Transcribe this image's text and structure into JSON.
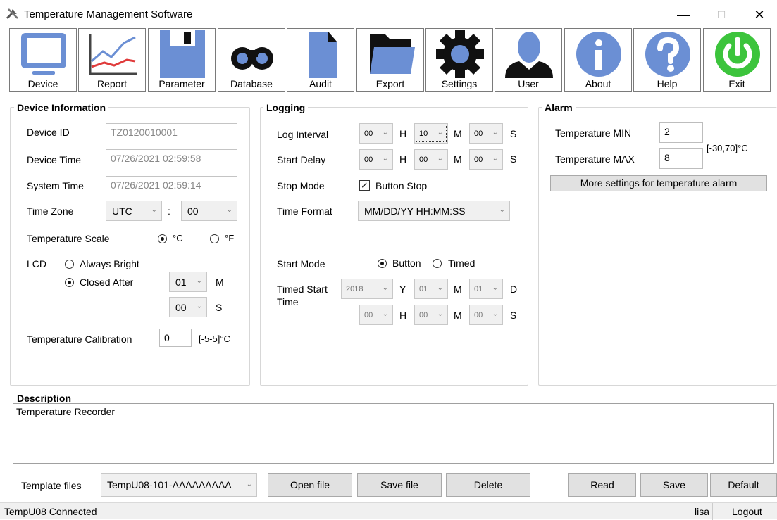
{
  "window": {
    "title": "Temperature Management Software",
    "minimize": "—",
    "maximize": "☐",
    "close": "✕"
  },
  "toolbar": [
    {
      "label": "Device",
      "icon": "monitor-icon"
    },
    {
      "label": "Report",
      "icon": "line-chart-icon"
    },
    {
      "label": "Parameter",
      "icon": "floppy-disk-icon"
    },
    {
      "label": "Database",
      "icon": "binoculars-icon"
    },
    {
      "label": "Audit",
      "icon": "document-icon"
    },
    {
      "label": "Export",
      "icon": "folder-icon"
    },
    {
      "label": "Settings",
      "icon": "gear-icon"
    },
    {
      "label": "User",
      "icon": "user-icon"
    },
    {
      "label": "About",
      "icon": "info-icon"
    },
    {
      "label": "Help",
      "icon": "help-icon"
    },
    {
      "label": "Exit",
      "icon": "power-icon"
    }
  ],
  "device": {
    "title": "Device Information",
    "id_label": "Device ID",
    "id_value": "TZ0120010001",
    "time_label": "Device Time",
    "time_value": "07/26/2021 02:59:58",
    "systime_label": "System Time",
    "systime_value": "07/26/2021 02:59:14",
    "tz_label": "Time Zone",
    "tz_value": "UTC",
    "tz_sep": ":",
    "tz_offset": "00",
    "scale_label": "Temperature Scale",
    "scale_c": "°C",
    "scale_f": "°F",
    "lcd_label": "LCD",
    "lcd_always": "Always Bright",
    "lcd_closed": "Closed After",
    "lcd_min_value": "01",
    "lcd_min_unit": "M",
    "lcd_sec_value": "00",
    "lcd_sec_unit": "S",
    "cal_label": "Temperature Calibration",
    "cal_value": "0",
    "cal_range": "[-5-5]°C"
  },
  "logging": {
    "title": "Logging",
    "interval_label": "Log Interval",
    "interval": [
      "00",
      "10",
      "00"
    ],
    "delay_label": "Start Delay",
    "delay": [
      "00",
      "00",
      "00"
    ],
    "units_hms": [
      "H",
      "M",
      "S"
    ],
    "stop_label": "Stop Mode",
    "stop_option": "Button Stop",
    "format_label": "Time Format",
    "format_value": "MM/DD/YY HH:MM:SS",
    "start_label": "Start Mode",
    "start_button": "Button",
    "start_timed": "Timed",
    "timed_label_1": "Timed Start",
    "timed_label_2": "Time",
    "timed_date": [
      "2018",
      "01",
      "01"
    ],
    "units_ymd": [
      "Y",
      "M",
      "D"
    ],
    "timed_time": [
      "00",
      "00",
      "00"
    ]
  },
  "alarm": {
    "title": "Alarm",
    "min_label": "Temperature MIN",
    "min_value": "2",
    "max_label": "Temperature MAX",
    "max_value": "8",
    "range": "[-30,70]°C",
    "more_button": "More settings for temperature alarm"
  },
  "description": {
    "title": "Description",
    "value": "Temperature Recorder"
  },
  "bottom": {
    "template_label": "Template files",
    "template_value": "TempU08-101-AAAAAAAAA",
    "open": "Open file",
    "save_file": "Save file",
    "delete": "Delete",
    "read": "Read",
    "save": "Save",
    "default": "Default"
  },
  "status": {
    "connection": "TempU08 Connected",
    "user": "lisa",
    "logout": "Logout"
  },
  "colors": {
    "icon_blue": "#6b8fd4",
    "exit_green": "#3cc43c",
    "report_red": "#e03b3b"
  }
}
